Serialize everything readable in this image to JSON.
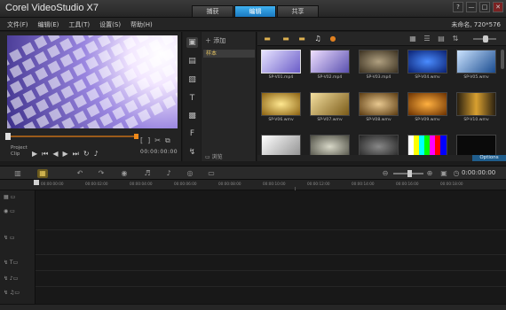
{
  "app": {
    "title": "Corel VideoStudio X7",
    "mode_tabs": [
      "捕获",
      "编辑",
      "共享"
    ],
    "active_tab": "编辑",
    "window_controls": [
      "?",
      "—",
      "□",
      "✕"
    ]
  },
  "menu": {
    "items": [
      "文件(F)",
      "编辑(E)",
      "工具(T)",
      "设置(S)",
      "帮助(H)"
    ],
    "project_info": "未命名, 720*576"
  },
  "preview": {
    "mode_labels": [
      "Project",
      "Clip"
    ],
    "timecode": "00:00:00:00"
  },
  "library": {
    "add_label": "添加",
    "selected_folder": "样本",
    "browse_label": "浏览",
    "options_label": "Options",
    "thumbs": [
      {
        "label": "SP-V01.mp4",
        "color": "#6a5cc8"
      },
      {
        "label": "SP-V02.mp4",
        "color": "#5a50b0"
      },
      {
        "label": "SP-V03.mp4",
        "color": "#6a5a3a"
      },
      {
        "label": "SP-V04.wmv",
        "color": "#1a48c0"
      },
      {
        "label": "SP-V05.wmv",
        "color": "#3a6fb0"
      },
      {
        "label": "SP-V06.wmv",
        "color": "#c89420"
      },
      {
        "label": "SP-V07.wmv",
        "color": "#b8902a"
      },
      {
        "label": "SP-V08.wmv",
        "color": "#a07a30"
      },
      {
        "label": "SP-V09.wmv",
        "color": "#b06a10"
      },
      {
        "label": "SP-V10.wmv",
        "color": "#c08a20"
      },
      {
        "label": "",
        "color": "#c0c0c0"
      },
      {
        "label": "",
        "color": "#8a8a7a"
      },
      {
        "label": "",
        "color": "#555555"
      },
      {
        "label": "",
        "color": "#a0a080"
      },
      {
        "label": "",
        "color": "#111111"
      }
    ]
  },
  "timeline": {
    "timecode": "0:00:00:00",
    "ruler": [
      "00:00:00:00",
      "00:00:02:00",
      "00:00:04:00",
      "00:00:06:00",
      "00:00:08:00",
      "00:00:10:00",
      "00:00:12:00",
      "00:00:14:00",
      "00:00:16:00",
      "00:00:18:00"
    ]
  }
}
